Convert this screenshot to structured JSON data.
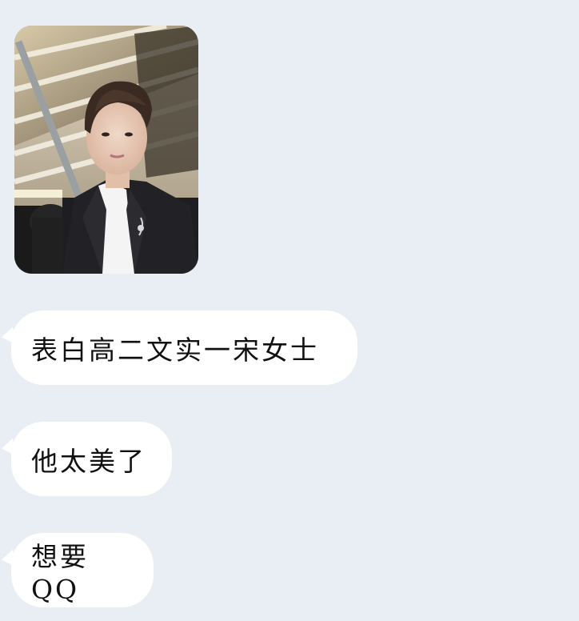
{
  "messages": [
    {
      "type": "image",
      "image_label": "selfie-photo"
    },
    {
      "type": "text",
      "text": "表白高二文实一宋女士"
    },
    {
      "type": "text",
      "text": "他太美了"
    },
    {
      "type": "text",
      "text": "想要QQ"
    }
  ],
  "colors": {
    "background": "#e9edf4",
    "bubble": "#ffffff",
    "text": "#111111"
  }
}
